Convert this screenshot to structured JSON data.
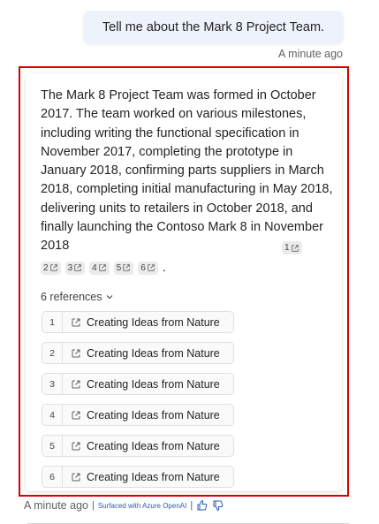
{
  "conversation": {
    "user_message": "Tell me about the Mark 8 Project Team.",
    "user_timestamp": "A minute ago",
    "bot_message": "The Mark 8 Project Team was formed in October 2017. The team worked on various milestones, including writing the functional specification in November 2017, completing the prototype in January 2018, confirming parts suppliers in March 2018, completing initial manufacturing in May 2018, delivering units to retailers in October 2018, and finally launching the Contoso Mark 8 in November 2018",
    "citations": [
      "1",
      "2",
      "3",
      "4",
      "5",
      "6"
    ],
    "end_punctuation": ".",
    "references_toggle": "6 references",
    "references": [
      {
        "num": "1",
        "title": "Creating Ideas from Nature"
      },
      {
        "num": "2",
        "title": "Creating Ideas from Nature"
      },
      {
        "num": "3",
        "title": "Creating Ideas from Nature"
      },
      {
        "num": "4",
        "title": "Creating Ideas from Nature"
      },
      {
        "num": "5",
        "title": "Creating Ideas from Nature"
      },
      {
        "num": "6",
        "title": "Creating Ideas from Nature"
      }
    ],
    "bot_timestamp": "A minute ago",
    "surfaced_label": "Surfaced with Azure OpenAI",
    "separator": "|"
  },
  "icons": {
    "external_link": "external-link-icon",
    "chevron": "chevron-down-icon",
    "like": "thumbs-up-icon",
    "dislike": "thumbs-down-icon"
  },
  "colors": {
    "highlight_border": "#d60000",
    "user_bubble": "#eef2fb",
    "surfaced_text": "#2a5bb0"
  }
}
